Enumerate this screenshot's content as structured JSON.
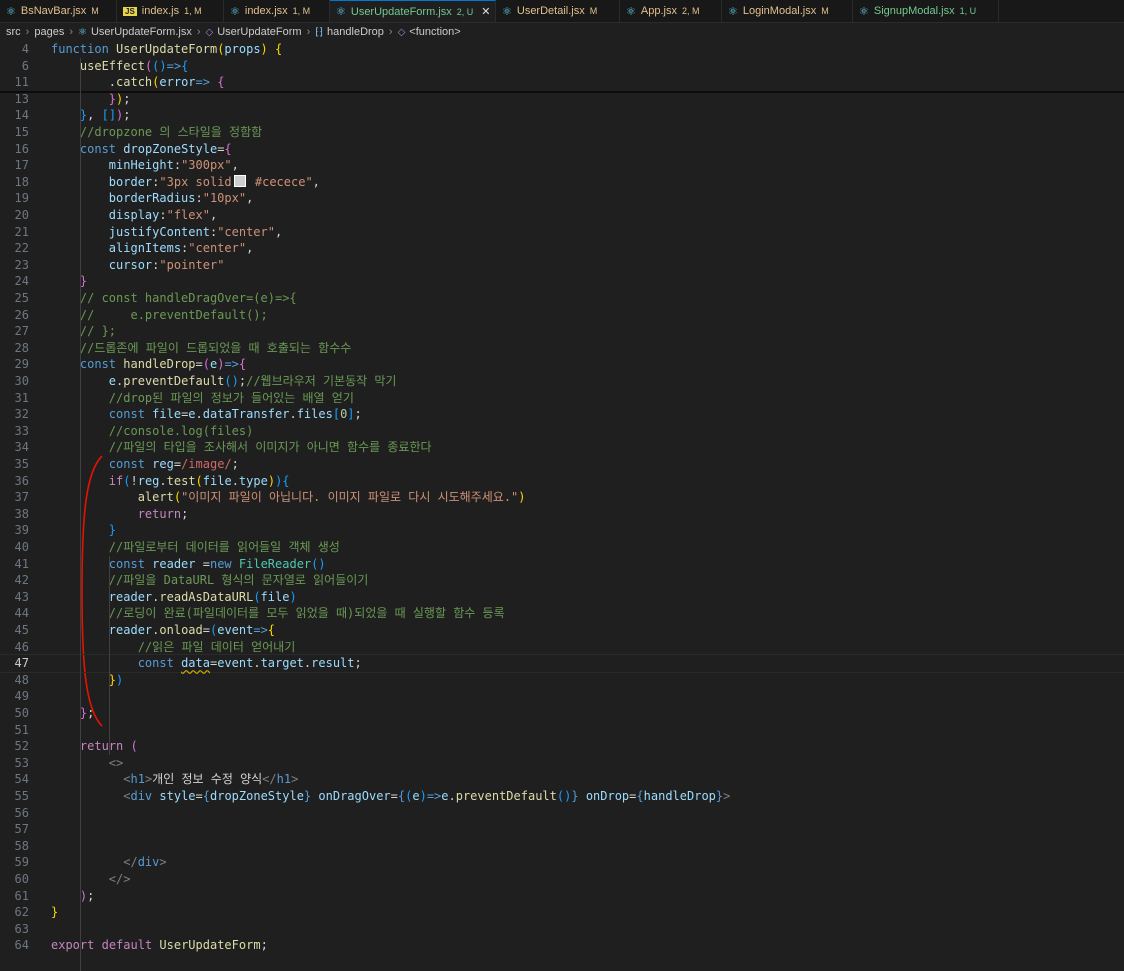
{
  "tabs": [
    {
      "label": "BsNavBar.jsx",
      "status": "M",
      "icon": "react",
      "color": "#e2c08d"
    },
    {
      "label": "index.js",
      "status": "1, M",
      "icon": "js",
      "color": "#e2c08d"
    },
    {
      "label": "index.jsx",
      "status": "1, M",
      "icon": "react",
      "color": "#e2c08d"
    },
    {
      "label": "UserUpdateForm.jsx",
      "status": "2, U",
      "icon": "react",
      "color": "#73c991",
      "active": true
    },
    {
      "label": "UserDetail.jsx",
      "status": "M",
      "icon": "react",
      "color": "#e2c08d"
    },
    {
      "label": "App.jsx",
      "status": "2, M",
      "icon": "react",
      "color": "#e2c08d"
    },
    {
      "label": "LoginModal.jsx",
      "status": "M",
      "icon": "react",
      "color": "#e2c08d"
    },
    {
      "label": "SignupModal.jsx",
      "status": "1, U",
      "icon": "react",
      "color": "#73c991"
    }
  ],
  "breadcrumb": [
    "src",
    "pages",
    "UserUpdateForm.jsx",
    "UserUpdateForm",
    "handleDrop",
    "<function>"
  ],
  "lines": [
    {
      "n": "4",
      "h": "<span class=\"k\">function</span> <span class=\"f\">UserUpdateForm</span><span class=\"b1\">(</span><span class=\"v\">props</span><span class=\"b1\">)</span> <span class=\"b1\">{</span>"
    },
    {
      "n": "6",
      "h": "    <span class=\"f\">useEffect</span><span class=\"b2\">(</span><span class=\"b3\">()</span><span class=\"k\">=&gt;</span><span class=\"b3\">{</span>"
    },
    {
      "n": "11",
      "h": "        .<span class=\"f\">catch</span><span class=\"b1\">(</span><span class=\"v\">error</span><span class=\"k\">=&gt;</span> <span class=\"b2\">{</span>"
    },
    {
      "n": "13",
      "h": "        <span class=\"b2\">}</span><span class=\"b1\">)</span>;"
    },
    {
      "n": "14",
      "h": "    <span class=\"b3\">}</span>, <span class=\"b3\">[]</span><span class=\"b2\">)</span>;"
    },
    {
      "n": "15",
      "h": "    <span class=\"cm\">//dropzone 의 스타일을 정함함</span>"
    },
    {
      "n": "16",
      "h": "    <span class=\"k\">const</span> <span class=\"v\">dropZoneStyle</span>=<span class=\"b2\">{</span>"
    },
    {
      "n": "17",
      "h": "        <span class=\"v\">minHeight</span>:<span class=\"s\">\"300px\"</span>,"
    },
    {
      "n": "18",
      "h": "        <span class=\"v\">border</span>:<span class=\"s\">\"3px solid<span class=\"sw\"></span> #cecece\"</span>,"
    },
    {
      "n": "19",
      "h": "        <span class=\"v\">borderRadius</span>:<span class=\"s\">\"10px\"</span>,"
    },
    {
      "n": "20",
      "h": "        <span class=\"v\">display</span>:<span class=\"s\">\"flex\"</span>,"
    },
    {
      "n": "21",
      "h": "        <span class=\"v\">justifyContent</span>:<span class=\"s\">\"center\"</span>,"
    },
    {
      "n": "22",
      "h": "        <span class=\"v\">alignItems</span>:<span class=\"s\">\"center\"</span>,"
    },
    {
      "n": "23",
      "h": "        <span class=\"v\">cursor</span>:<span class=\"s\">\"pointer\"</span>"
    },
    {
      "n": "24",
      "h": "    <span class=\"b2\">}</span>"
    },
    {
      "n": "25",
      "h": "    <span class=\"cm\">// const handleDragOver=(e)=&gt;{</span>"
    },
    {
      "n": "26",
      "h": "    <span class=\"cm\">//     e.preventDefault();</span>"
    },
    {
      "n": "27",
      "h": "    <span class=\"cm\">// };</span>"
    },
    {
      "n": "28",
      "h": "    <span class=\"cm\">//드롭존에 파일이 드롭되었을 때 호출되는 함수수</span>"
    },
    {
      "n": "29",
      "h": "    <span class=\"k\">const</span> <span class=\"f\">handleDrop</span>=<span class=\"b2\">(</span><span class=\"v\">e</span><span class=\"b2\">)</span><span class=\"k\">=&gt;</span><span class=\"b2\">{</span>"
    },
    {
      "n": "30",
      "h": "        <span class=\"v\">e</span>.<span class=\"f\">preventDefault</span><span class=\"b3\">()</span>;<span class=\"cm\">//웹브라우저 기본동작 막기</span>"
    },
    {
      "n": "31",
      "h": "        <span class=\"cm\">//drop된 파일의 정보가 들어있는 배열 얻기</span>"
    },
    {
      "n": "32",
      "h": "        <span class=\"k\">const</span> <span class=\"v\">file</span>=<span class=\"v\">e</span>.<span class=\"v\">dataTransfer</span>.<span class=\"v\">files</span><span class=\"b3\">[</span><span class=\"n\">0</span><span class=\"b3\">]</span>;"
    },
    {
      "n": "33",
      "h": "        <span class=\"cm\">//console.log(files)</span>"
    },
    {
      "n": "34",
      "h": "        <span class=\"cm\">//파일의 타입을 조사해서 이미지가 아니면 함수를 종료한다</span>"
    },
    {
      "n": "35",
      "h": "        <span class=\"k\">const</span> <span class=\"v\">reg</span>=<span class=\"rx\">/image/</span>;"
    },
    {
      "n": "36",
      "h": "        <span class=\"c\">if</span><span class=\"b3\">(</span>!<span class=\"v\">reg</span>.<span class=\"f\">test</span><span class=\"b1\">(</span><span class=\"v\">file</span>.<span class=\"v\">type</span><span class=\"b1\">)</span><span class=\"b3\">)</span><span class=\"b3\">{</span>"
    },
    {
      "n": "37",
      "h": "            <span class=\"f\">alert</span><span class=\"b1\">(</span><span class=\"s\">\"이미지 파일이 아닙니다. 이미지 파일로 다시 시도해주세요.\"</span><span class=\"b1\">)</span>"
    },
    {
      "n": "38",
      "h": "            <span class=\"c\">return</span>;"
    },
    {
      "n": "39",
      "h": "        <span class=\"b3\">}</span>"
    },
    {
      "n": "40",
      "h": "        <span class=\"cm\">//파일로부터 데이터를 읽어들일 객체 생성</span>"
    },
    {
      "n": "41",
      "h": "        <span class=\"k\">const</span> <span class=\"v\">reader</span> =<span class=\"k\">new</span> <span class=\"t\">FileReader</span><span class=\"b3\">()</span>"
    },
    {
      "n": "42",
      "h": "        <span class=\"cm\">//파일을 DataURL 형식의 문자열로 읽어들이기</span>"
    },
    {
      "n": "43",
      "h": "        <span class=\"v\">reader</span>.<span class=\"f\">readAsDataURL</span><span class=\"b3\">(</span><span class=\"v\">file</span><span class=\"b3\">)</span>"
    },
    {
      "n": "44",
      "h": "        <span class=\"cm\">//로딩이 완료(파일데이터를 모두 읽었을 때)되었을 때 실행할 함수 등록</span>"
    },
    {
      "n": "45",
      "h": "        <span class=\"v\">reader</span>.<span class=\"f\">onload</span>=<span class=\"b3\">(</span><span class=\"v\">event</span><span class=\"k\">=&gt;</span><span class=\"b1\">{</span>"
    },
    {
      "n": "46",
      "h": "            <span class=\"cm\">//읽은 파일 데이터 얻어내기</span>"
    },
    {
      "n": "47",
      "h": "            <span class=\"k\">const</span> <span class=\"v sq\">data</span>=<span class=\"v\">event</span>.<span class=\"v\">target</span>.<span class=\"v\">result</span>;",
      "cur": true
    },
    {
      "n": "48",
      "h": "        <span class=\"b1\">}</span><span class=\"b3\">)</span>"
    },
    {
      "n": "49",
      "h": ""
    },
    {
      "n": "50",
      "h": "    <span class=\"b2\">}</span>;"
    },
    {
      "n": "51",
      "h": ""
    },
    {
      "n": "52",
      "h": "    <span class=\"c\">return</span> <span class=\"b2\">(</span>"
    },
    {
      "n": "53",
      "h": "        <span class=\"tg\">&lt;&gt;</span>"
    },
    {
      "n": "54",
      "h": "          <span class=\"tg\">&lt;</span><span class=\"k\">h1</span><span class=\"tg\">&gt;</span>개인 정보 수정 양식<span class=\"tg\">&lt;/</span><span class=\"k\">h1</span><span class=\"tg\">&gt;</span>"
    },
    {
      "n": "55",
      "h": "          <span class=\"tg\">&lt;</span><span class=\"k\">div</span> <span class=\"v\">style</span>=<span class=\"k\">{</span><span class=\"v\">dropZoneStyle</span><span class=\"k\">}</span> <span class=\"v\">onDragOver</span>=<span class=\"k\">{</span><span class=\"b3\">(</span><span class=\"v\">e</span><span class=\"b3\">)</span><span class=\"k\">=&gt;</span><span class=\"v\">e</span>.<span class=\"f\">preventDefault</span><span class=\"b3\">()</span><span class=\"k\">}</span> <span class=\"v\">onDrop</span>=<span class=\"k\">{</span><span class=\"v\">handleDrop</span><span class=\"k\">}</span><span class=\"tg\">&gt;</span>"
    },
    {
      "n": "56",
      "h": ""
    },
    {
      "n": "57",
      "h": ""
    },
    {
      "n": "58",
      "h": ""
    },
    {
      "n": "59",
      "h": "          <span class=\"tg\">&lt;/</span><span class=\"k\">div</span><span class=\"tg\">&gt;</span>"
    },
    {
      "n": "60",
      "h": "        <span class=\"tg\">&lt;/&gt;</span>"
    },
    {
      "n": "61",
      "h": "    <span class=\"b2\">)</span>;"
    },
    {
      "n": "62",
      "h": "<span class=\"b1\">}</span>"
    },
    {
      "n": "63",
      "h": ""
    },
    {
      "n": "64",
      "h": "<span class=\"c\">export</span> <span class=\"c\">default</span> <span class=\"f\">UserUpdateForm</span>;"
    }
  ],
  "annotation_color": "#e51400"
}
